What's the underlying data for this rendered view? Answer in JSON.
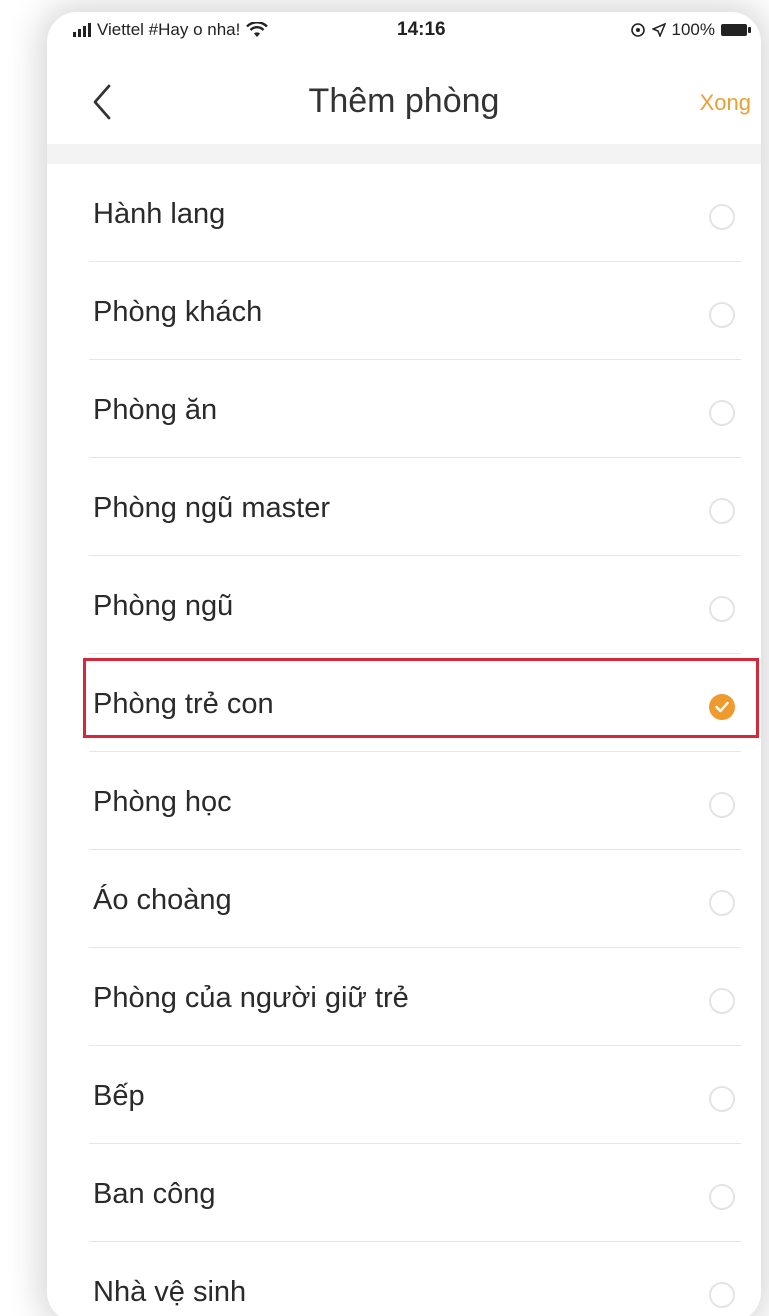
{
  "status_bar": {
    "carrier": "Viettel #Hay o nha!",
    "time": "14:16",
    "battery": "100%"
  },
  "nav": {
    "title": "Thêm phòng",
    "done_label": "Xong"
  },
  "colors": {
    "accent": "#ef9a2c",
    "done_text": "#e8a035",
    "highlight": "#d6283a"
  },
  "rooms": [
    {
      "label": "Hành lang",
      "selected": false
    },
    {
      "label": "Phòng khách",
      "selected": false
    },
    {
      "label": "Phòng ăn",
      "selected": false
    },
    {
      "label": "Phòng ngũ master",
      "selected": false
    },
    {
      "label": "Phòng ngũ",
      "selected": false
    },
    {
      "label": "Phòng trẻ con",
      "selected": true
    },
    {
      "label": "Phòng học",
      "selected": false
    },
    {
      "label": "Áo choàng",
      "selected": false
    },
    {
      "label": "Phòng của người giữ trẻ",
      "selected": false
    },
    {
      "label": "Bếp",
      "selected": false
    },
    {
      "label": "Ban công",
      "selected": false
    },
    {
      "label": "Nhà vệ sinh",
      "selected": false
    }
  ]
}
